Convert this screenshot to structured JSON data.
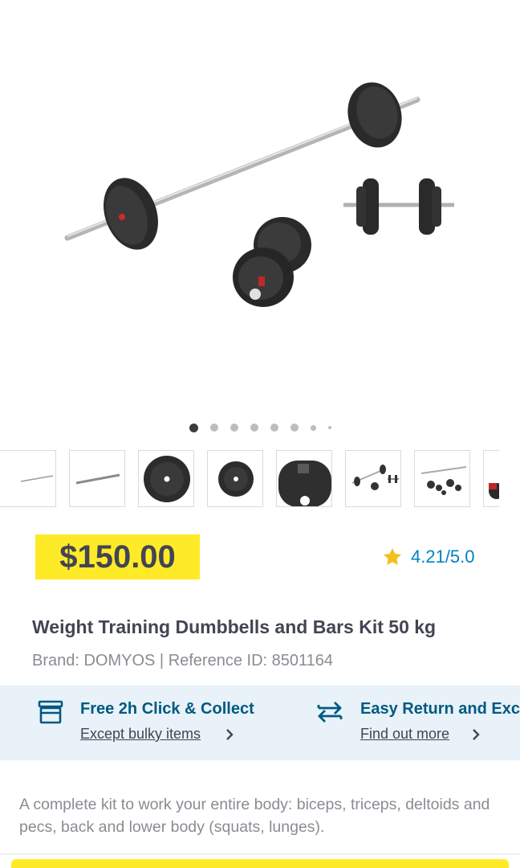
{
  "gallery": {
    "hero_alt": "barbell and dumbbells kit",
    "dots_count": 8,
    "active_dot": 0
  },
  "price": "$150.00",
  "rating": {
    "value": "4.21/5.0",
    "star_icon": "star-icon",
    "star_color": "#f4c01e"
  },
  "product": {
    "title": "Weight Training Dumbbells and Bars Kit 50 kg",
    "brand_line": "Brand: DOMYOS | Reference ID: 8501164"
  },
  "services": [
    {
      "icon": "store-icon",
      "title": "Free 2h Click & Collect",
      "link": "Except bulky items"
    },
    {
      "icon": "return-arrows-icon",
      "title": "Easy Return and Exc",
      "link": "Find out more"
    }
  ],
  "description": "A complete kit to work your entire body: biceps, triceps, deltoids and pecs, back and lower body (squats, lunges).",
  "colors": {
    "price_bg": "#ffea28",
    "accent_blue": "#0082c3",
    "service_bg": "#e8f2f8",
    "service_title": "#005980"
  }
}
